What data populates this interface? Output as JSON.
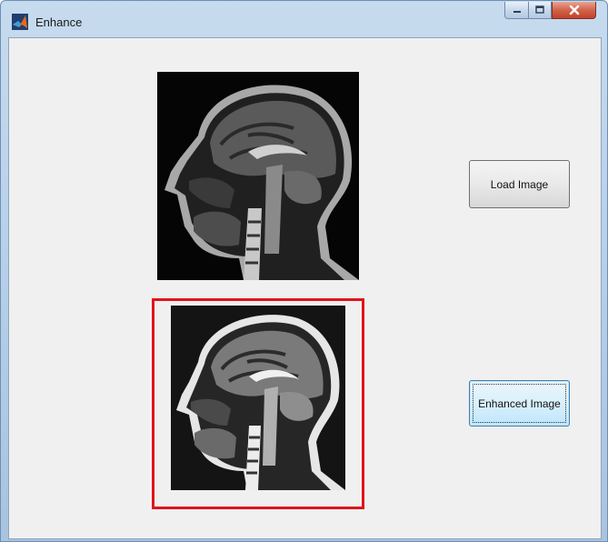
{
  "window": {
    "title": "Enhance",
    "title_icon": "matlab-logo-icon",
    "controls": [
      "minimize-icon",
      "maximize-icon",
      "close-icon"
    ]
  },
  "images": {
    "original": "sagittal-brain-mri",
    "enhanced": "sagittal-brain-mri-enhanced"
  },
  "buttons": {
    "load_label": "Load Image",
    "enhance_label": "Enhanced Image"
  },
  "colors": {
    "highlight_border": "#e0141c",
    "focused_button": "#bee6fd"
  }
}
